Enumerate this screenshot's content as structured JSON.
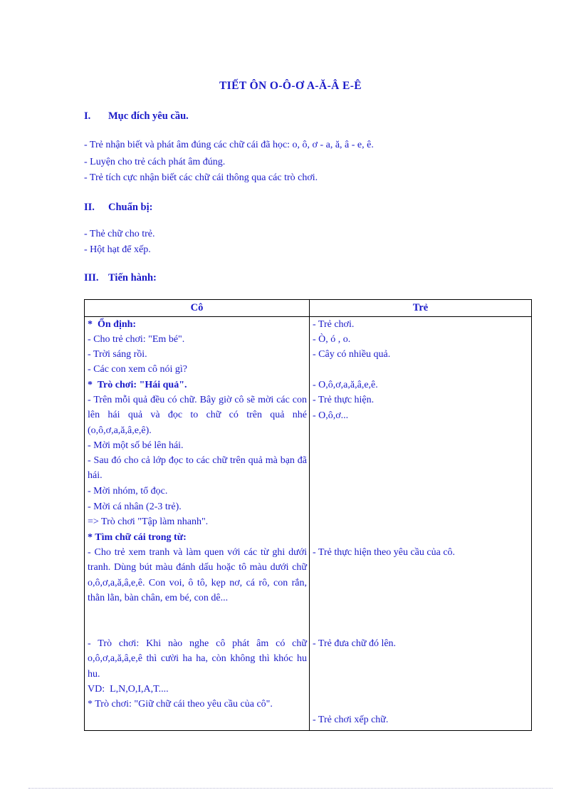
{
  "document": {
    "title": "TIẾT ÔN O-Ô-Ơ  A-Ă-Â  E-Ê",
    "sections": [
      {
        "numeral": "I.",
        "heading": "Mục đích yêu cầu.",
        "lines": [
          "- Trẻ nhận biết và phát âm đúng các chữ cái đã học: o, ô, ơ - a, ă, â - e, ê.",
          "- Luyện cho trẻ cách phát âm đúng.",
          "- Trẻ tích cực nhận biết các chữ cái thông qua các trò chơi."
        ]
      },
      {
        "numeral": "II.",
        "heading": "Chuẩn bị:",
        "lines": [
          "- Thẻ chữ cho trẻ.",
          "- Hột hạt để xếp."
        ]
      },
      {
        "numeral": "III.",
        "heading": "Tiến hành:",
        "lines": []
      }
    ]
  },
  "table": {
    "headers": {
      "teacher": "Cô",
      "child": "Trẻ"
    },
    "teacher_lines": [
      {
        "text": "*  Ổn định:",
        "bold": true
      },
      {
        "text": "- Cho trẻ chơi: \"Em bé\".",
        "bold": false
      },
      {
        "text": "- Trời sáng rồi.",
        "bold": false
      },
      {
        "text": "- Các con xem cô nói gì?",
        "bold": false
      },
      {
        "text": "*  Trò chơi: \"Hái quả\".",
        "bold": true
      },
      {
        "text": "- Trên mỗi quả đều có chữ. Bây giờ cô sẽ mời các con lên hái quả và đọc to chữ có trên quả nhé (o,ô,ơ,a,ă,â,e,ê).",
        "bold": false
      },
      {
        "text": "- Mời một số bé lên hái.",
        "bold": false
      },
      {
        "text": "- Sau đó cho cả lớp đọc to các chữ trên quả mà bạn đã hái.",
        "bold": false
      },
      {
        "text": "- Mời nhóm, tổ đọc.",
        "bold": false
      },
      {
        "text": "- Mời cá nhân (2-3 trẻ).",
        "bold": false
      },
      {
        "text": "=> Trò chơi \"Tập làm nhanh\".",
        "bold": false
      },
      {
        "text": "* Tìm chữ cái trong từ:",
        "bold": true
      },
      {
        "text": "- Cho trẻ xem tranh và làm quen với các từ ghi dưới tranh. Dùng bút màu đánh dấu hoặc tô màu dưới chữ o,ô,ơ,a,ă,â,e,ê. Con voi, ô tô, kẹp nơ, cá rô, con rắn, thằn lằn, bàn chân, em bé, con dê...",
        "bold": false
      },
      {
        "text": "- Trò chơi: Khi nào nghe cô phát âm có chữ o,ô,ơ,a,ă,â,e,ê thì cười ha ha, còn không thì khóc hu hu.",
        "bold": false
      },
      {
        "text": "VD:  L,N,O,I,A,T....",
        "bold": false
      },
      {
        "text": "* Trò chơi: \"Giữ chữ cái theo yêu cầu của cô\".",
        "bold": true
      }
    ],
    "child_lines": [
      {
        "text": "- Trẻ chơi.",
        "bold": false
      },
      {
        "text": "- Ò, ó , o.",
        "bold": false
      },
      {
        "text": "- Cây có nhiều quả.",
        "bold": false
      },
      {
        "text": "- O,ô,ơ,a,ă,â,e,ê.",
        "bold": false
      },
      {
        "text": "- Trẻ thực hiện.",
        "bold": false
      },
      {
        "text": "- O,ô,ơ...",
        "bold": false
      },
      {
        "text": "- Trẻ thực hiện theo yêu cầu của cô.",
        "bold": false
      },
      {
        "text": "- Trẻ đưa chữ đó lên.",
        "bold": false
      },
      {
        "text": "- Trẻ chơi xếp chữ.",
        "bold": false
      }
    ]
  },
  "colors": {
    "text": "#1a1ac8",
    "border": "#000000",
    "page": "#ffffff"
  }
}
